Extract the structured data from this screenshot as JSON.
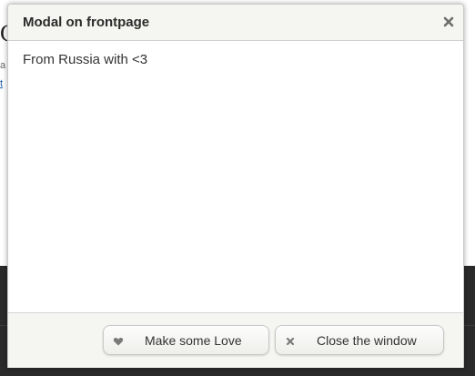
{
  "background": {
    "title_fragment": "C",
    "meta_fragment": "a",
    "link_fragment": "t"
  },
  "modal": {
    "title": "Modal on frontpage",
    "body_text": "From Russia with <3",
    "buttons": {
      "love_label": "Make some Love",
      "close_label": "Close the window"
    },
    "icons": {
      "close": "close-icon",
      "love": "heart-icon",
      "close_window": "close-icon"
    }
  },
  "colors": {
    "header_bg": "#f5f5f2",
    "overlay_dark": "#2a2a2a",
    "link": "#1e5aa8"
  }
}
